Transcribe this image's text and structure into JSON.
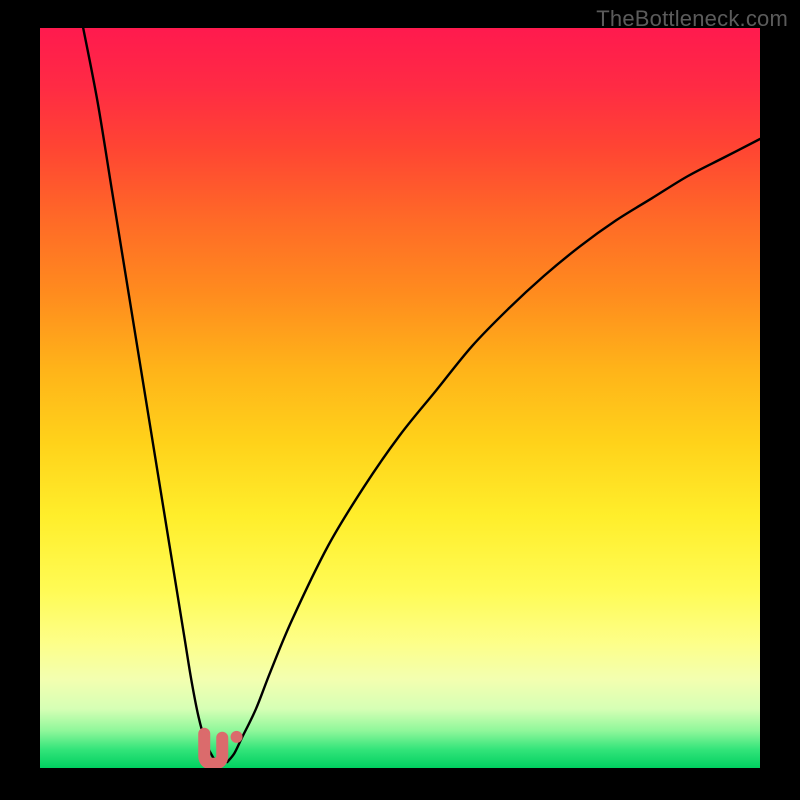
{
  "watermark": "TheBottleneck.com",
  "colors": {
    "curve_stroke": "#000000",
    "marker_fill": "#db6b6c",
    "marker_stroke": "#c85a5b",
    "background_black": "#000000"
  },
  "chart_data": {
    "type": "line",
    "title": "",
    "xlabel": "",
    "ylabel": "",
    "xlim": [
      0,
      100
    ],
    "ylim": [
      0,
      100
    ],
    "grid": false,
    "background": "gradient red→green (bottleneck severity)",
    "series": [
      {
        "name": "left-curve",
        "x": [
          6,
          8,
          10,
          12,
          14,
          16,
          18,
          20,
          21,
          22,
          23,
          24,
          24.5
        ],
        "y": [
          100,
          90,
          78,
          66,
          54,
          42,
          30,
          18,
          12,
          7,
          3.5,
          1.5,
          0.8
        ]
      },
      {
        "name": "right-curve",
        "x": [
          26,
          27,
          28,
          30,
          32,
          35,
          40,
          45,
          50,
          55,
          60,
          65,
          70,
          75,
          80,
          85,
          90,
          95,
          100
        ],
        "y": [
          0.8,
          2,
          4,
          8,
          13,
          20,
          30,
          38,
          45,
          51,
          57,
          62,
          66.5,
          70.5,
          74,
          77,
          80,
          82.5,
          85
        ]
      }
    ],
    "marker": {
      "description": "rounded-U marker at curve minimum plus small dot",
      "u_center_x": 24.2,
      "u_center_y": 2.2,
      "dot_x": 27.3,
      "dot_y": 4.2
    }
  }
}
